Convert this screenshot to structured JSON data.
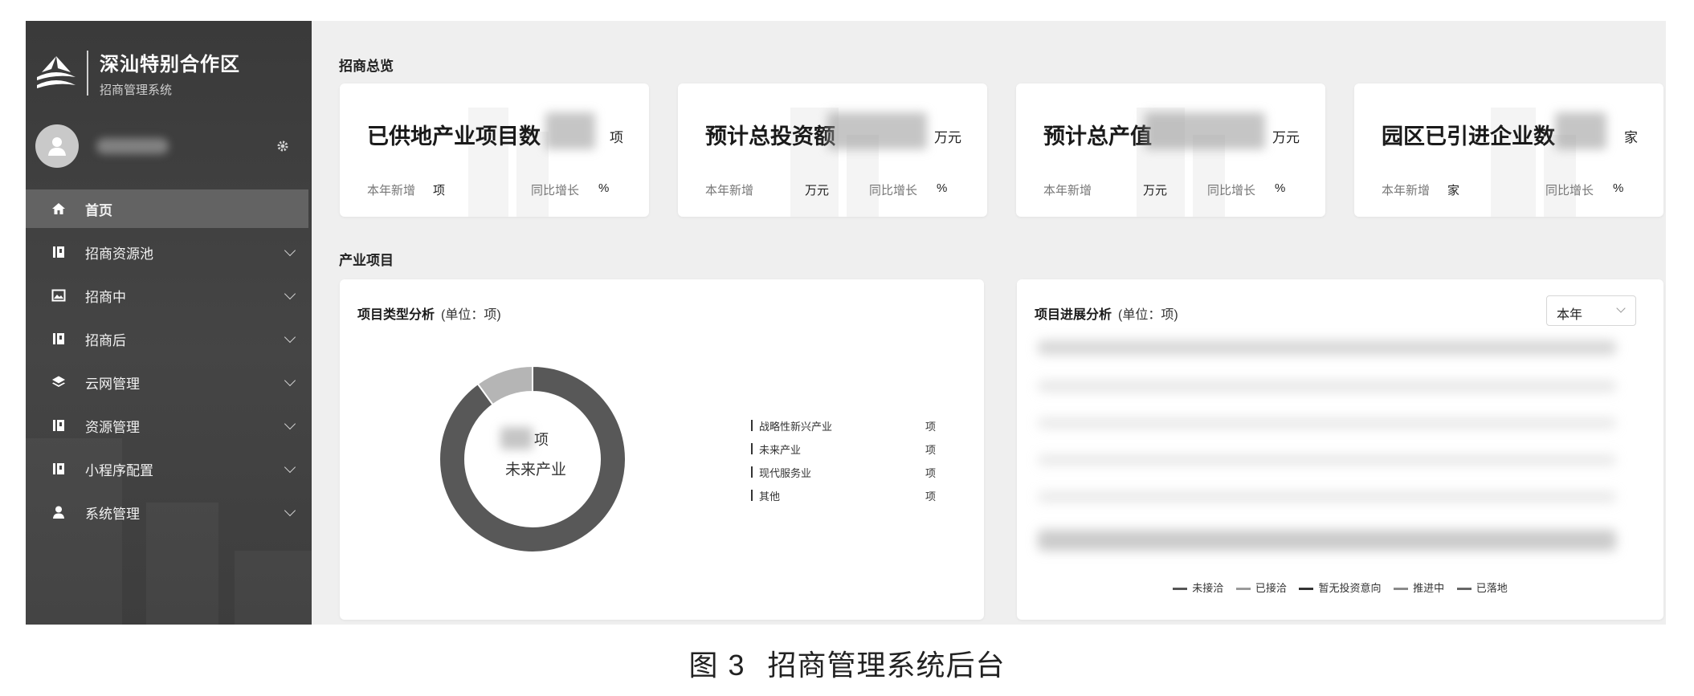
{
  "sidebar": {
    "brand_title": "深汕特别合作区",
    "brand_subtitle": "招商管理系统",
    "menu": [
      {
        "label": "首页",
        "icon": "home-icon",
        "active": true,
        "expandable": false
      },
      {
        "label": "招商资源池",
        "icon": "book-icon",
        "active": false,
        "expandable": true
      },
      {
        "label": "招商中",
        "icon": "image-icon",
        "active": false,
        "expandable": true
      },
      {
        "label": "招商后",
        "icon": "book-icon",
        "active": false,
        "expandable": true
      },
      {
        "label": "云网管理",
        "icon": "layers-icon",
        "active": false,
        "expandable": true
      },
      {
        "label": "资源管理",
        "icon": "book-icon",
        "active": false,
        "expandable": true
      },
      {
        "label": "小程序配置",
        "icon": "book-icon",
        "active": false,
        "expandable": true
      },
      {
        "label": "系统管理",
        "icon": "user-icon",
        "active": false,
        "expandable": true
      }
    ]
  },
  "overview": {
    "title": "招商总览",
    "cards": [
      {
        "label": "已供地产业项目数",
        "unit": "项",
        "new_label": "本年新增",
        "new_unit": "项",
        "growth_label": "同比增长",
        "growth_unit": "%"
      },
      {
        "label": "预计总投资额",
        "unit": "万元",
        "new_label": "本年新增",
        "new_unit": "万元",
        "growth_label": "同比增长",
        "growth_unit": "%"
      },
      {
        "label": "预计总产值",
        "unit": "万元",
        "new_label": "本年新增",
        "new_unit": "万元",
        "growth_label": "同比增长",
        "growth_unit": "%"
      },
      {
        "label": "园区已引进企业数",
        "unit": "家",
        "new_label": "本年新增",
        "new_unit": "家",
        "growth_label": "同比增长",
        "growth_unit": "%"
      }
    ]
  },
  "projects": {
    "title": "产业项目",
    "type_panel": {
      "title": "项目类型分析",
      "unit_note": "(单位：项)",
      "center_unit": "项",
      "center_name": "未来产业",
      "legend": [
        {
          "label": "战略性新兴产业",
          "unit": "项"
        },
        {
          "label": "未来产业",
          "unit": "项"
        },
        {
          "label": "现代服务业",
          "unit": "项"
        },
        {
          "label": "其他",
          "unit": "项"
        }
      ]
    },
    "progress_panel": {
      "title": "项目进展分析",
      "unit_note": "(单位：项)",
      "select_value": "本年",
      "legend": [
        {
          "label": "未接洽",
          "color": "#555555"
        },
        {
          "label": "已接洽",
          "color": "#9a9a9a"
        },
        {
          "label": "暂无投资意向",
          "color": "#333333"
        },
        {
          "label": "推进中",
          "color": "#8a8a8a"
        },
        {
          "label": "已落地",
          "color": "#666666"
        }
      ]
    }
  },
  "chart_data": {
    "type": "pie",
    "values": [
      90,
      10
    ],
    "colors": [
      "#585858",
      "#b5b5b5"
    ]
  },
  "caption": {
    "fig": "图",
    "num": "3",
    "text": "招商管理系统后台"
  }
}
